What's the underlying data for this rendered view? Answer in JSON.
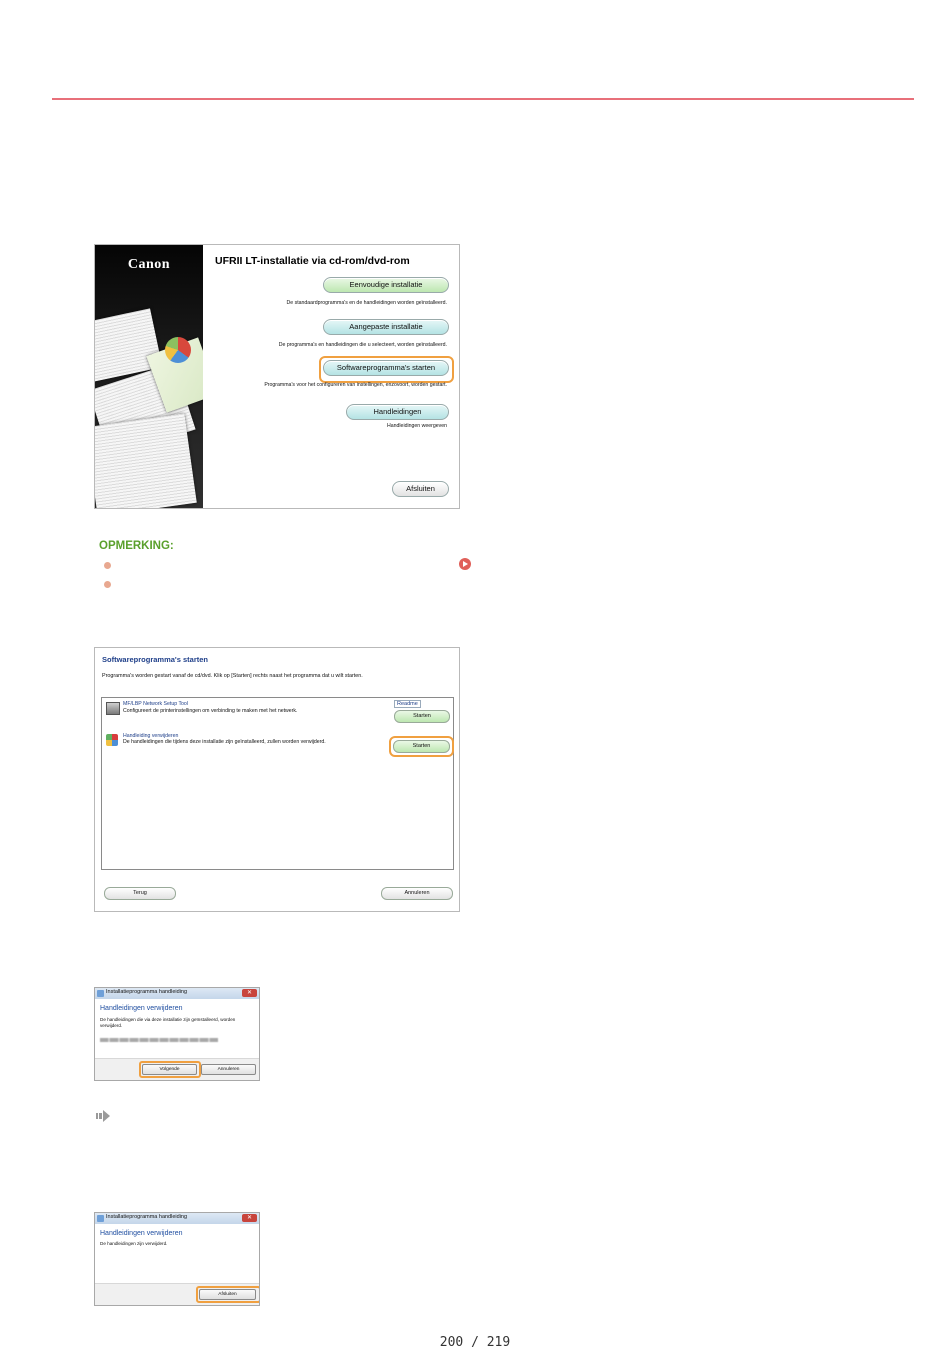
{
  "installer": {
    "brand": "Canon",
    "title": "UFRII LT-installatie via cd-rom/dvd-rom",
    "buttons": {
      "easy": "Eenvoudige installatie",
      "custom": "Aangepaste installatie",
      "software": "Softwareprogramma's starten",
      "manuals": "Handleidingen",
      "close": "Afsluiten"
    },
    "descriptions": {
      "easy": "De standaardprogramma's en de handleidingen worden geïnstalleerd.",
      "custom": "De programma's en handleidingen die u selecteert, worden geïnstalleerd.",
      "software": "Programma's voor het configureren van instellingen, enzovoort, worden gestart.",
      "manuals": "Handleidingen weergeven"
    }
  },
  "note": {
    "title": "OPMERKING:"
  },
  "software_dialog": {
    "title": "Softwareprogramma's starten",
    "description": "Programma's worden gestart vanaf de cd/dvd. Klik op [Starten] rechts naast het programma dat u wilt starten.",
    "programs": [
      {
        "name": "MF/LBP Network Setup Tool",
        "description": "Configureert de printerinstellingen om verbinding te maken met het netwerk.",
        "readme_label": "Readme",
        "start_label": "Starten"
      },
      {
        "name": "Handleiding verwijderen",
        "description": "De handleidingen die tijdens deze installatie zijn geïnstalleerd, zullen worden verwijderd.",
        "start_label": "Starten"
      }
    ],
    "back_label": "Terug",
    "cancel_label": "Annuleren"
  },
  "uninstall_dialog": {
    "window_title": "Installatieprogramma handleiding",
    "heading": "Handleidingen verwijderen",
    "text": "De handleidingen die via deze installatie zijn geïnstalleerd, worden verwijderd.",
    "next_label": "Volgende",
    "cancel_label": "Annuleren",
    "close_glyph": "✕"
  },
  "done_dialog": {
    "window_title": "Installatieprogramma handleiding",
    "heading": "Handleidingen verwijderen",
    "text": "De handleidingen zijn verwijderd.",
    "finish_label": "Afsluiten",
    "close_glyph": "✕"
  },
  "page": {
    "number": "200 / 219"
  }
}
